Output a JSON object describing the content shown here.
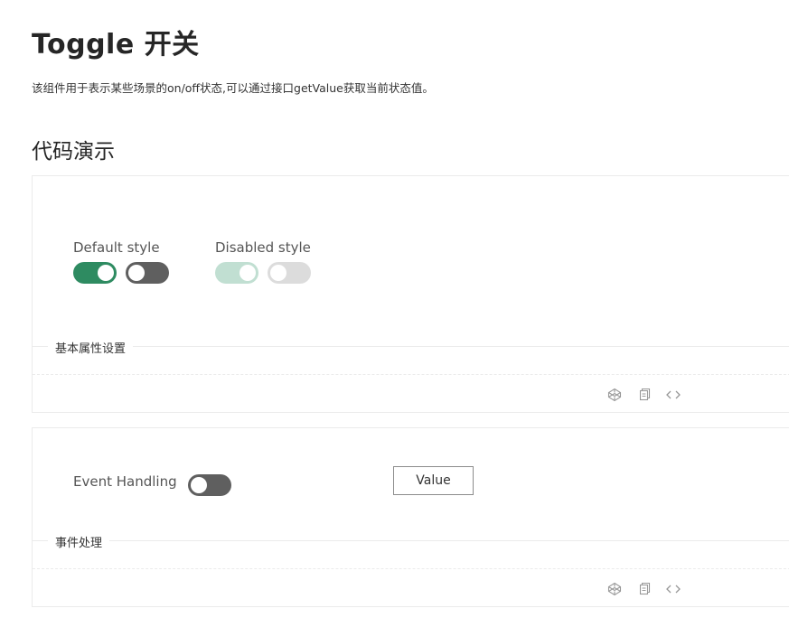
{
  "header": {
    "title": "Toggle 开关",
    "description": "该组件用于表示某些场景的on/off状态,可以通过接口getValue获取当前状态值。"
  },
  "section": {
    "title": "代码演示"
  },
  "demos": [
    {
      "groups": [
        {
          "label": "Default style",
          "toggles": [
            {
              "state": "on",
              "disabled": false
            },
            {
              "state": "off",
              "disabled": false
            }
          ]
        },
        {
          "label": "Disabled style",
          "toggles": [
            {
              "state": "on",
              "disabled": true
            },
            {
              "state": "off",
              "disabled": true
            }
          ]
        }
      ],
      "meta_title": "基本属性设置",
      "actions": [
        "codepen-icon",
        "copy-icon",
        "code-icon"
      ]
    },
    {
      "label": "Event Handling",
      "toggle": {
        "state": "off",
        "disabled": false
      },
      "button_label": "Value",
      "meta_title": "事件处理",
      "actions": [
        "codepen-icon",
        "copy-icon",
        "code-icon"
      ]
    }
  ],
  "colors": {
    "toggle_on": "#2e8b61",
    "toggle_off": "#5f5f5f",
    "toggle_disabled_on": "#c1dfd2",
    "toggle_disabled_off": "#dcdcdc",
    "border": "#ebebeb",
    "icon": "#999999"
  }
}
